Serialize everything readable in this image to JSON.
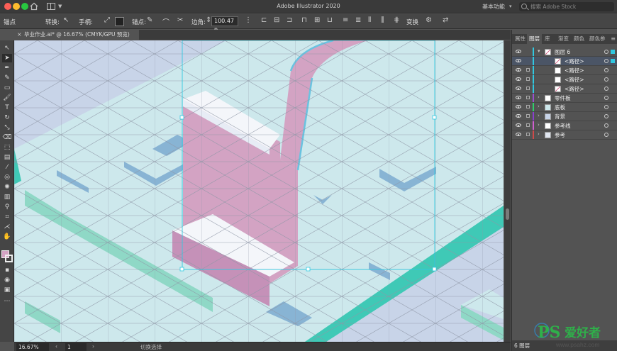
{
  "titlebar": {
    "app_title": "Adobe Illustrator 2020",
    "workspace": "基本功能",
    "workspace_caret": "▾",
    "search_placeholder": "搜索 Adobe Stock"
  },
  "controlbar": {
    "anchor_label": "锚点",
    "convert_label": "转换:",
    "handles_label": "手柄:",
    "anchors_label": "锚点:",
    "corner_label": "边角:",
    "corner_value": "100.47 n",
    "transform_label": "变换"
  },
  "document": {
    "tab_title": "毕业作业.ai* @ 16.67% (CMYK/GPU 预览)",
    "close_glyph": "×"
  },
  "statusbar": {
    "zoom": "16.67%",
    "page": "1",
    "status_text": "切换选择",
    "prev_glyph": "‹",
    "next_glyph": "›"
  },
  "panel": {
    "tabs": [
      "属性",
      "图层",
      "库",
      "渐变",
      "颜色",
      "颜色参"
    ],
    "menu_glyph": "≡",
    "layers": [
      {
        "name": "图层 6",
        "color": "#31c8e0"
      },
      {
        "name": "<路径>",
        "color": "#31c8e0"
      },
      {
        "name": "<路径>",
        "color": "#31c8e0"
      },
      {
        "name": "<路径>",
        "color": "#31c8e0"
      },
      {
        "name": "<路径>",
        "color": "#31c8e0"
      },
      {
        "name": "零件板",
        "color": "#9b4fd0"
      },
      {
        "name": "底板",
        "color": "#2fd06a"
      },
      {
        "name": "背景",
        "color": "#8a3fd0"
      },
      {
        "name": "参考线",
        "color": "#d05fd0"
      },
      {
        "name": "参考",
        "color": "#d04a4a"
      }
    ],
    "footer": "6 图层"
  },
  "watermark": {
    "brand": "PS",
    "tagline": "爱好者",
    "url": "www.psahz.com"
  },
  "colors": {
    "canvas_bg": "#c8d4e8",
    "platform_top": "#cde8ec",
    "platform_side": "#3fc9b6",
    "letter_face": "#d3a3c3",
    "letter_top": "#f4f6fa",
    "selection": "#31c8e0"
  }
}
